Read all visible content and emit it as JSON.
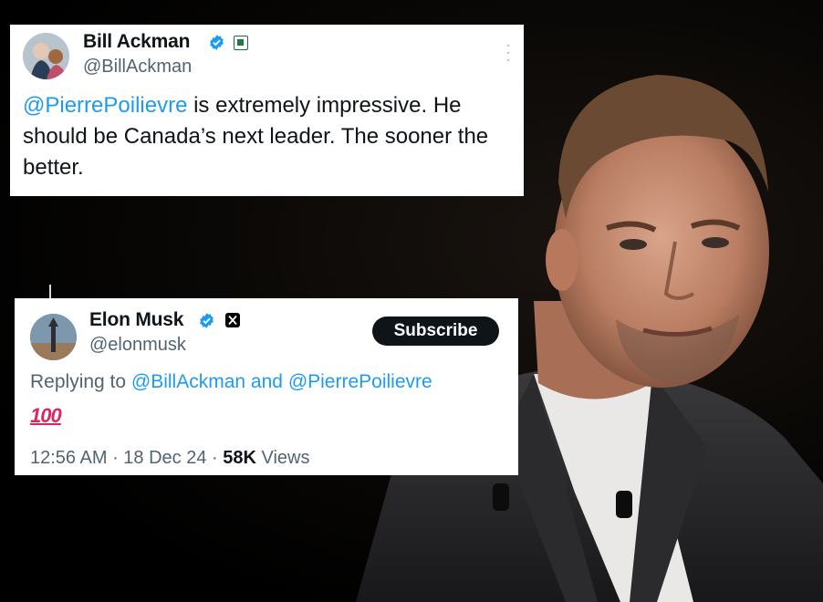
{
  "ackman_tweet": {
    "display_name": "Bill Ackman",
    "handle": "@BillAckman",
    "mention": "@PierrePoilievre",
    "text_rest": " is extremely impressive. He should be Canada’s next leader. The sooner the better."
  },
  "musk_tweet": {
    "display_name": "Elon Musk",
    "handle": "@elonmusk",
    "subscribe_label": "Subscribe",
    "reply_prefix": "Replying to ",
    "reply_mention_1": "@BillAckman",
    "reply_and": " and ",
    "reply_mention_2": "@PierrePoilievre",
    "emoji": "100",
    "time": "12:56 AM",
    "sep1": " · ",
    "date": "18 Dec 24",
    "sep2": " · ",
    "views_count": "58K",
    "views_label": " Views"
  },
  "colors": {
    "link": "#1d9bf0",
    "verified": "#1d9bf0",
    "text": "#0f1419",
    "muted": "#536471",
    "emoji_red": "#e0245e"
  },
  "icons": [
    "verified-badge-icon",
    "affiliation-badge-icon",
    "x-logo-icon",
    "more-options-icon"
  ]
}
